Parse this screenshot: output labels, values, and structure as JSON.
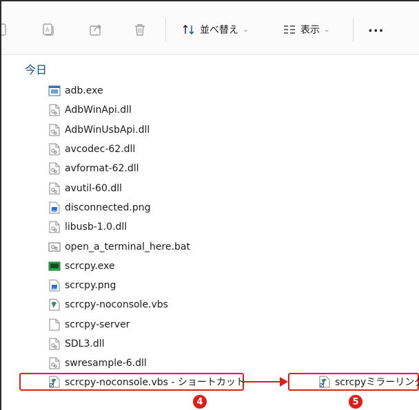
{
  "toolbar": {
    "sort_label": "並べ替え",
    "view_label": "表示",
    "more_label": "..."
  },
  "group": {
    "title": "今日"
  },
  "files": [
    {
      "name": "adb.exe",
      "icon": "exe-window-icon"
    },
    {
      "name": "AdbWinApi.dll",
      "icon": "dll-icon"
    },
    {
      "name": "AdbWinUsbApi.dll",
      "icon": "dll-icon"
    },
    {
      "name": "avcodec-62.dll",
      "icon": "dll-icon"
    },
    {
      "name": "avformat-62.dll",
      "icon": "dll-icon"
    },
    {
      "name": "avutil-60.dll",
      "icon": "dll-icon"
    },
    {
      "name": "disconnected.png",
      "icon": "image-icon"
    },
    {
      "name": "libusb-1.0.dll",
      "icon": "dll-icon"
    },
    {
      "name": "open_a_terminal_here.bat",
      "icon": "bat-icon"
    },
    {
      "name": "scrcpy.exe",
      "icon": "exe-green-icon"
    },
    {
      "name": "scrcpy.png",
      "icon": "image-icon"
    },
    {
      "name": "scrcpy-noconsole.vbs",
      "icon": "script-icon"
    },
    {
      "name": "scrcpy-server",
      "icon": "blank-file-icon"
    },
    {
      "name": "SDL3.dll",
      "icon": "dll-icon"
    },
    {
      "name": "swresample-6.dll",
      "icon": "dll-icon"
    }
  ],
  "shortcut": {
    "name": "scrcpy-noconsole.vbs - ショートカット",
    "icon": "script-shortcut-icon"
  },
  "renamed": {
    "name": "scrcpyミラーリング",
    "icon": "script-shortcut-icon"
  },
  "badges": {
    "step4": "4",
    "step5": "5"
  },
  "colors": {
    "highlight": "#e11a1a",
    "header_text": "#1a4a7a"
  }
}
